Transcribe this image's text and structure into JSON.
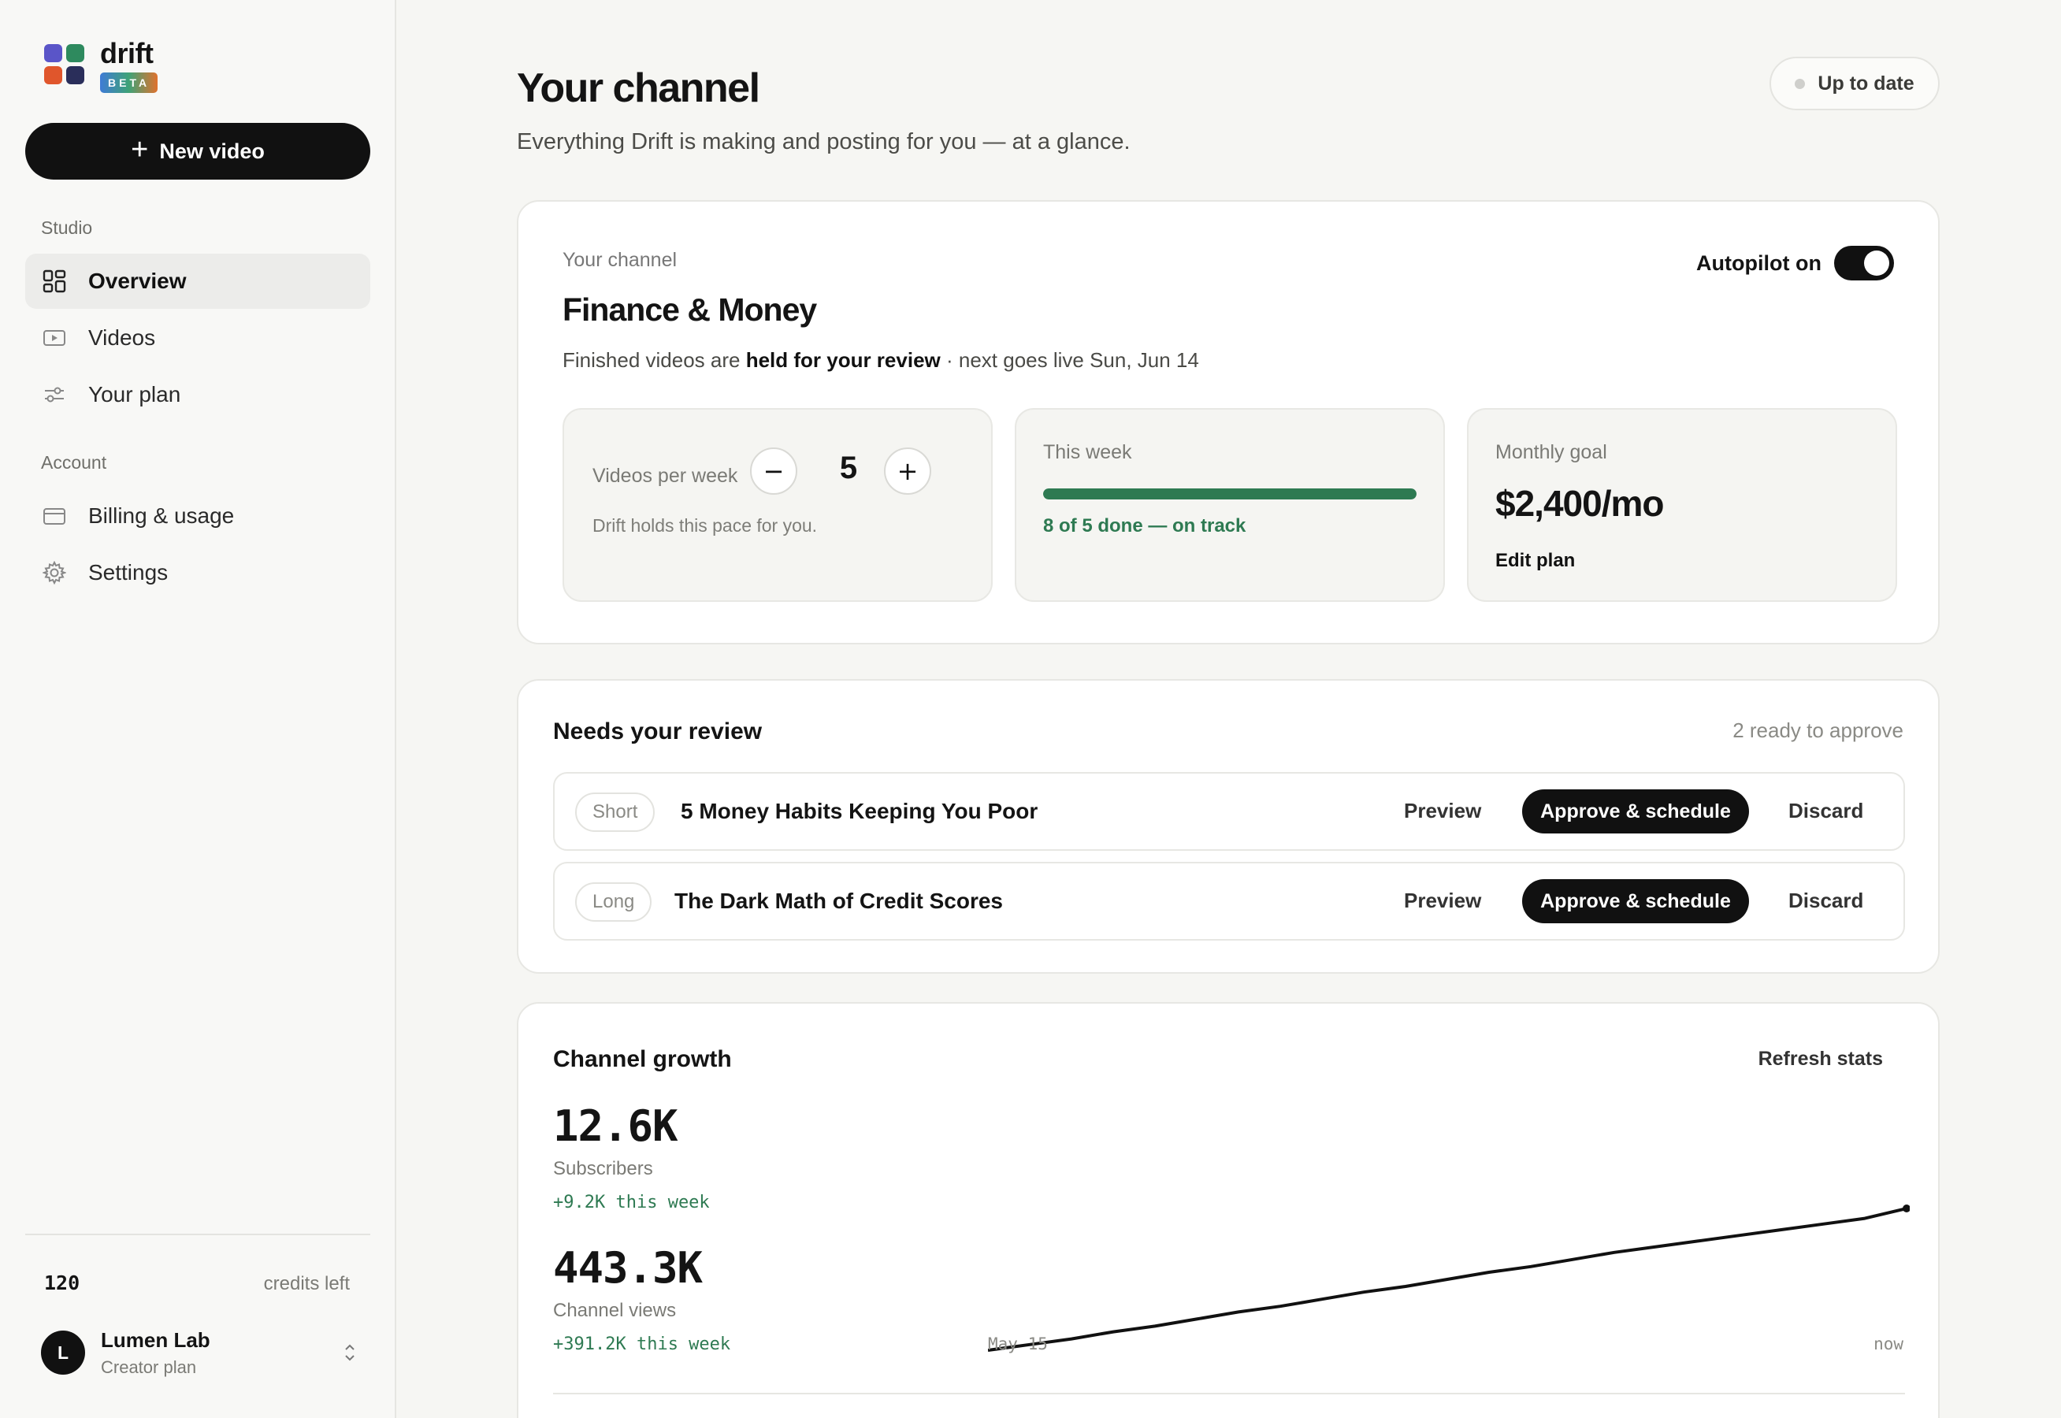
{
  "app": {
    "name": "drift",
    "badge": "BETA",
    "logo_colors": [
      "#5a55c8",
      "#2e8a5e",
      "#e0562c",
      "#2a2e5a"
    ]
  },
  "sidebar": {
    "new_video_label": "New video",
    "sections": {
      "studio": "Studio",
      "account": "Account"
    },
    "items": [
      {
        "label": "Overview",
        "icon": "grid-icon",
        "active": true
      },
      {
        "label": "Videos",
        "icon": "video-icon",
        "active": false
      },
      {
        "label": "Your plan",
        "icon": "sliders-icon",
        "active": false
      },
      {
        "label": "Billing & usage",
        "icon": "card-icon",
        "active": false
      },
      {
        "label": "Settings",
        "icon": "gear-icon",
        "active": false
      }
    ],
    "credits": {
      "value": "120",
      "label": "credits left"
    },
    "account": {
      "initial": "L",
      "name": "Lumen Lab",
      "plan": "Creator plan"
    }
  },
  "header": {
    "title": "Your channel",
    "subtitle": "Everything Drift is making and posting for you — at a glance.",
    "status": "Up to date"
  },
  "channel": {
    "label": "Your channel",
    "name": "Finance & Money",
    "desc_prefix": "Finished videos are ",
    "desc_bold": "held for your review",
    "desc_suffix": " · next goes live Sun, Jun 14",
    "autopilot_label": "Autopilot on",
    "autopilot_on": true,
    "videos_per_week": {
      "label": "Videos per week",
      "value": "5",
      "note": "Drift holds this pace for you."
    },
    "this_week": {
      "label": "This week",
      "status": "8 of 5 done — on track",
      "progress": 1.0
    },
    "monthly_goal": {
      "label": "Monthly goal",
      "value": "$2,400/mo",
      "edit_label": "Edit plan"
    }
  },
  "review": {
    "title": "Needs your review",
    "count": "2 ready to approve",
    "preview_label": "Preview",
    "approve_label": "Approve & schedule",
    "discard_label": "Discard",
    "rows": [
      {
        "type": "Short",
        "title": "5 Money Habits Keeping You Poor"
      },
      {
        "type": "Long",
        "title": "The Dark Math of Credit Scores"
      }
    ]
  },
  "growth": {
    "title": "Channel growth",
    "refresh_label": "Refresh stats",
    "subscribers": {
      "value": "12.6K",
      "label": "Subscribers",
      "delta": "+9.2K this week"
    },
    "views": {
      "value": "443.3K",
      "label": "Channel views",
      "delta": "+391.2K this week"
    }
  },
  "chart_data": {
    "type": "line",
    "x_start_label": "May 15",
    "x_end_label": "now",
    "series": [
      {
        "values": [
          0.0,
          0.04,
          0.08,
          0.13,
          0.17,
          0.22,
          0.27,
          0.31,
          0.36,
          0.41,
          0.45,
          0.5,
          0.55,
          0.59,
          0.64,
          0.69,
          0.73,
          0.77,
          0.81,
          0.85,
          0.89,
          0.93,
          1.0
        ]
      }
    ],
    "line_color": "#111111"
  }
}
